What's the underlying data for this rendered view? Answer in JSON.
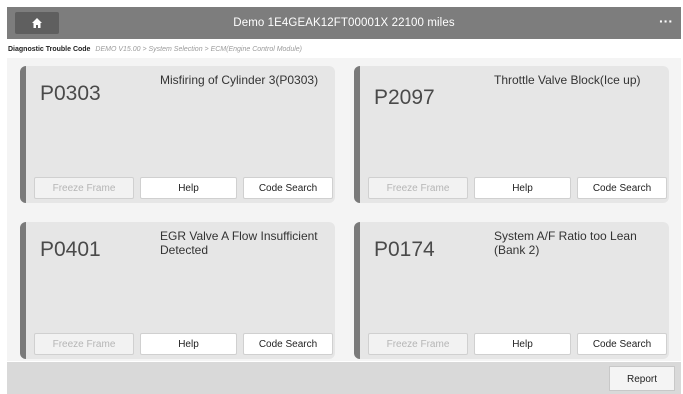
{
  "header": {
    "title": "Demo  1E4GEAK12FT00001X  22100 miles",
    "more_label": "···"
  },
  "breadcrumb": {
    "lead": "Diagnostic Trouble Code",
    "path": "DEMO V15.00 > System Selection > ECM(Engine Control Module)"
  },
  "cards": [
    {
      "code": "P0303",
      "desc": "Misfiring of Cylinder 3(P0303)",
      "btn1": "Freeze Frame",
      "btn2": "Help",
      "btn3": "Code Search"
    },
    {
      "code": "P2097",
      "desc": "Throttle Valve Block(Ice up)",
      "btn1": "Freeze Frame",
      "btn2": "Help",
      "btn3": "Code Search"
    },
    {
      "code": "P0401",
      "desc": "EGR Valve A Flow Insufficient Detected",
      "btn1": "Freeze Frame",
      "btn2": "Help",
      "btn3": "Code Search"
    },
    {
      "code": "P0174",
      "desc": "System A/F Ratio too Lean (Bank 2)",
      "btn1": "Freeze Frame",
      "btn2": "Help",
      "btn3": "Code Search"
    }
  ],
  "footer": {
    "report_label": "Report"
  }
}
